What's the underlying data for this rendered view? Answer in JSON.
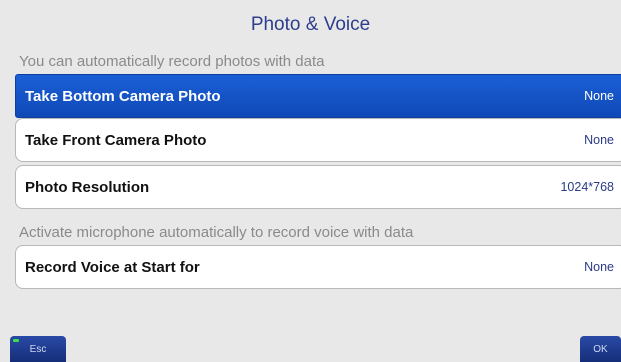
{
  "window": {
    "title": "Photo & Voice"
  },
  "photo_section": {
    "label": "You can automatically record photos with data",
    "items": [
      {
        "label": "Take Bottom Camera Photo",
        "value": "None",
        "selected": true
      },
      {
        "label": "Take Front Camera Photo",
        "value": "None",
        "selected": false
      },
      {
        "label": "Photo Resolution",
        "value": "1024*768",
        "selected": false
      }
    ]
  },
  "voice_section": {
    "label": "Activate microphone automatically to record voice with data",
    "items": [
      {
        "label": "Record Voice at Start for",
        "value": "None",
        "selected": false
      }
    ]
  },
  "softkeys": {
    "esc_label": "Esc",
    "ok_label": "OK"
  },
  "colors": {
    "accent": "#1b5fd6",
    "title": "#2d3e8c",
    "softkey": "#1d3a8e",
    "esc_indicator": "#3fdc4a"
  }
}
